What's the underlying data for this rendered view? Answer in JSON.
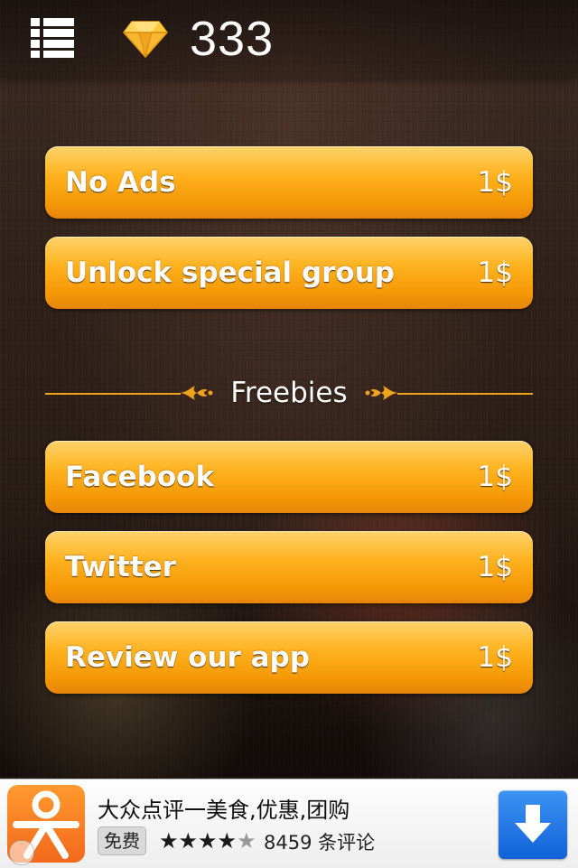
{
  "header": {
    "menu_icon": "list-menu-icon",
    "gem_icon": "diamond-icon",
    "gem_count": "333"
  },
  "purchases": [
    {
      "label": "No Ads",
      "price": "1$"
    },
    {
      "label": "Unlock special group",
      "price": "1$"
    }
  ],
  "freebies_section": {
    "title": "Freebies",
    "items": [
      {
        "label": "Facebook",
        "price": "1$"
      },
      {
        "label": "Twitter",
        "price": "1$"
      },
      {
        "label": "Review our app",
        "price": "1$"
      }
    ]
  },
  "ad": {
    "app_name": "大众点评一美食,优惠,团购",
    "free_badge": "免费",
    "rating": 4,
    "rating_max": 5,
    "reviews": "8459 条评论",
    "download_icon": "download-arrow-icon",
    "info_icon": "info-icon"
  },
  "colors": {
    "button_orange": "#f59806",
    "accent_line": "#f1a21d",
    "download_blue": "#1162d8"
  }
}
